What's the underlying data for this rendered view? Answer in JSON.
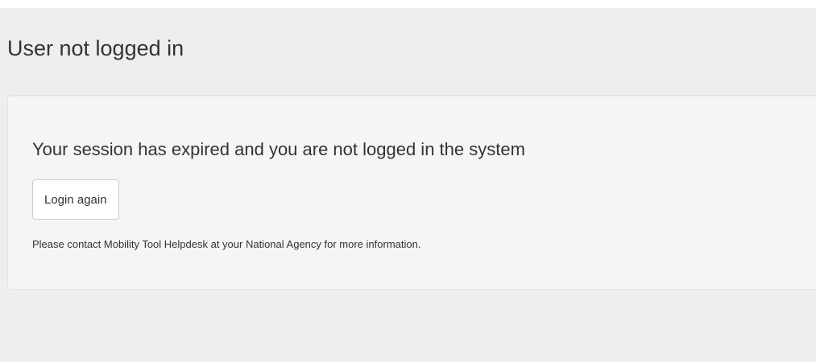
{
  "page": {
    "title": "User not logged in"
  },
  "panel": {
    "heading": "Your session has expired and you are not logged in the system",
    "login_button_label": "Login again",
    "help_text": "Please contact Mobility Tool Helpdesk at your National Agency for more information."
  },
  "colors": {
    "page_background": "#eeeeee",
    "panel_background": "#f5f5f5",
    "panel_border": "#e3e3e3",
    "button_background": "#ffffff",
    "button_border": "#cccccc",
    "text": "#333333"
  }
}
